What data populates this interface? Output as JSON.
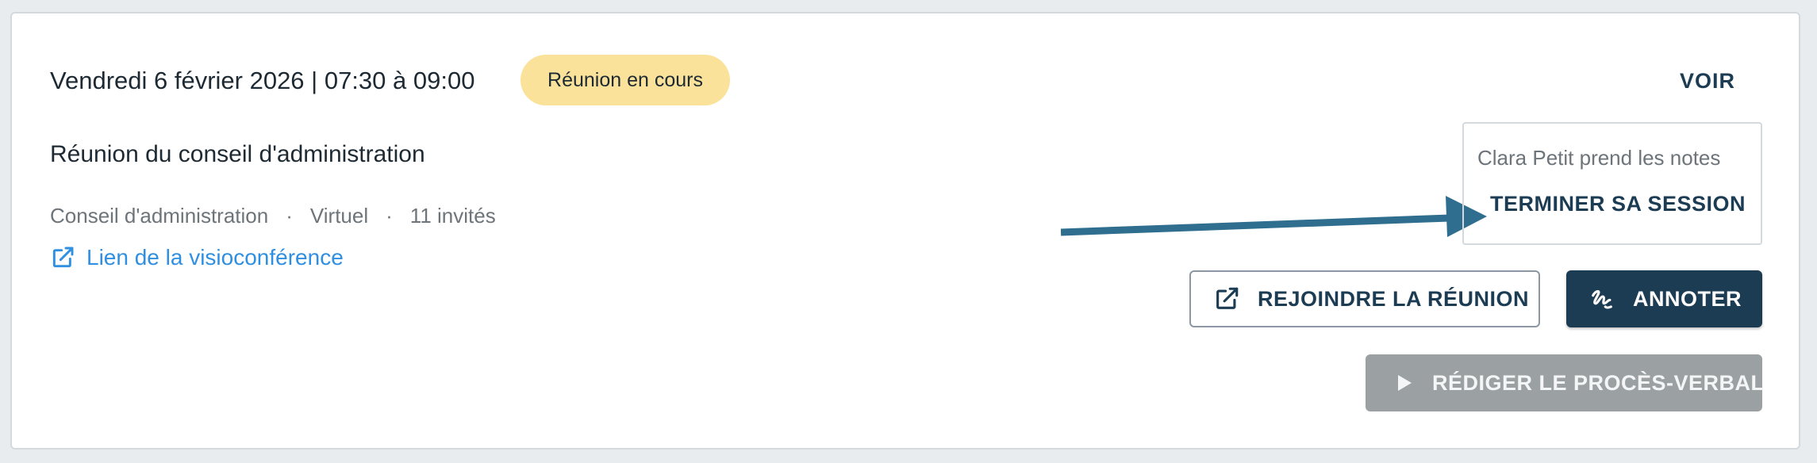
{
  "meeting": {
    "date_line": "Vendredi 6 février 2026 | 07:30 à 09:00",
    "status_badge": "Réunion en cours",
    "view_link": "VOIR",
    "title": "Réunion du conseil d'administration",
    "meta": [
      "Conseil d'administration",
      "Virtuel",
      "11 invités"
    ],
    "meta_separator": "·",
    "video_link": "Lien de la visioconférence"
  },
  "notes": {
    "taker_text": "Clara Petit prend les notes",
    "end_session": "TERMINER SA SESSION"
  },
  "actions": {
    "join": "REJOINDRE LA RÉUNION",
    "annotate": "ANNOTER",
    "write_minutes": "RÉDIGER LE PROCÈS-VERBAL"
  },
  "icons": {
    "external_link": "external-link-icon",
    "annotate": "signature-icon",
    "play": "play-icon",
    "arrow": "callout-arrow"
  },
  "colors": {
    "accent_dark": "#1c3c54",
    "badge_bg": "#fbe29a",
    "link_blue": "#2f8fe0",
    "arrow": "#2f6e8e",
    "disabled": "#9ba0a3"
  }
}
